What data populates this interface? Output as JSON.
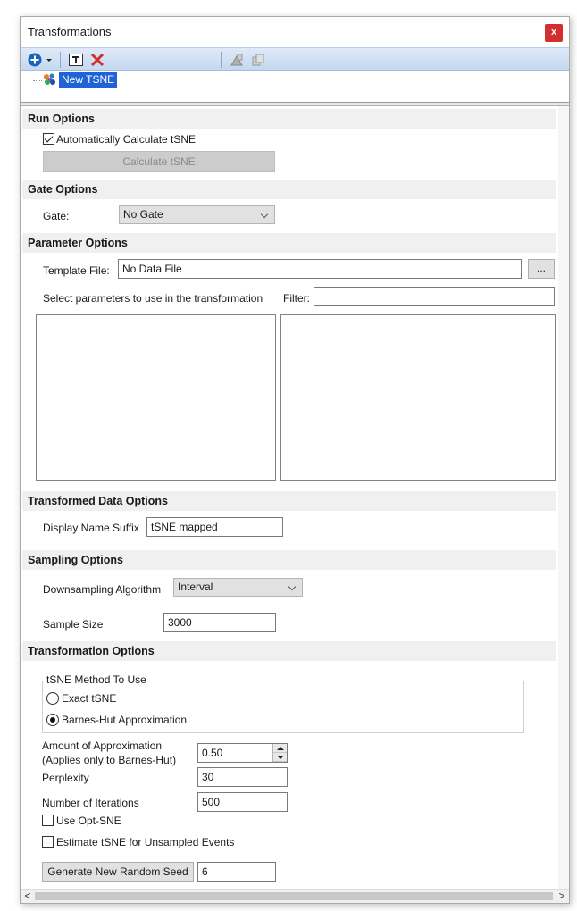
{
  "window": {
    "title": "Transformations",
    "close_label": "x"
  },
  "toolbar": {
    "icons": [
      "add-icon",
      "dropdown-arrow-icon",
      "rename-icon",
      "delete-icon",
      "export-icon",
      "copy-icon"
    ]
  },
  "tree": {
    "item_label": "New TSNE"
  },
  "run_options": {
    "header": "Run Options",
    "auto_calc_label": "Automatically Calculate tSNE",
    "auto_calc_checked": true,
    "calc_button": "Calculate tSNE"
  },
  "gate_options": {
    "header": "Gate Options",
    "gate_label": "Gate:",
    "gate_value": "No Gate"
  },
  "parameter_options": {
    "header": "Parameter Options",
    "template_label": "Template File:",
    "template_value": "No Data File",
    "browse_label": "...",
    "select_label": "Select parameters to use in the transformation",
    "filter_label": "Filter:",
    "filter_value": ""
  },
  "transformed_data_options": {
    "header": "Transformed Data Options",
    "suffix_label": "Display Name Suffix",
    "suffix_value": "tSNE mapped"
  },
  "sampling_options": {
    "header": "Sampling Options",
    "algorithm_label": "Downsampling Algorithm",
    "algorithm_value": "Interval",
    "sample_size_label": "Sample Size",
    "sample_size_value": "3000"
  },
  "transformation_options": {
    "header": "Transformation Options",
    "method_group_title": "tSNE Method To Use",
    "method_exact": "Exact tSNE",
    "method_barnes": "Barnes-Hut Approximation",
    "selected_method": "Barnes-Hut Approximation",
    "approx_label_1": "Amount of Approximation",
    "approx_label_2": "(Applies only to Barnes-Hut)",
    "approx_value": "0.50",
    "perplexity_label": "Perplexity",
    "perplexity_value": "30",
    "iterations_label": "Number of Iterations",
    "iterations_value": "500",
    "opt_sne_label": "Use Opt-SNE",
    "opt_sne_checked": false,
    "estimate_label": "Estimate tSNE for Unsampled Events",
    "estimate_checked": false,
    "seed_button": "Generate New Random Seed",
    "seed_value": "6"
  },
  "scrollbar": {
    "left_arrow": "<",
    "right_arrow": ">"
  },
  "colors": {
    "selection": "#1f63d6",
    "close": "#d32f2f",
    "section_bg": "#f0f0f0"
  }
}
